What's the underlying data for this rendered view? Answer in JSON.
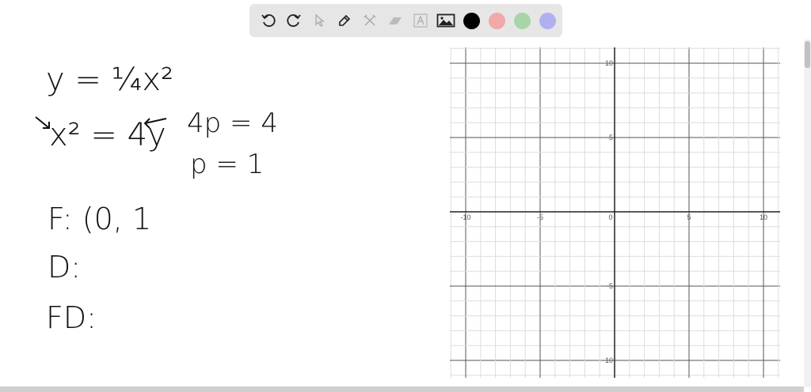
{
  "toolbar": {
    "tools": [
      "undo-icon",
      "redo-icon",
      "select-icon",
      "pen-icon",
      "tools-icon",
      "eraser-icon",
      "text-icon",
      "image-icon"
    ],
    "colors": [
      "#000000",
      "#f0a8a8",
      "#a8d4a8",
      "#b0b0f0"
    ]
  },
  "notes": {
    "line1": "y = ¼x²",
    "line2": "x² = 4y",
    "line3": "4p = 4",
    "line4": "p = 1",
    "line5": "F: (0, 1",
    "line6": "D:",
    "line7": "FD:"
  },
  "chart_data": {
    "type": "scatter",
    "title": "",
    "xlim": [
      -11,
      11
    ],
    "ylim": [
      -11,
      11
    ],
    "grid": true,
    "minor_step": 1,
    "major_step": 5,
    "x_tick_labels": [
      "-10",
      "-5",
      "0",
      "5",
      "10"
    ],
    "y_tick_labels": [
      "10",
      "5",
      "-5",
      "-10"
    ],
    "series": []
  }
}
